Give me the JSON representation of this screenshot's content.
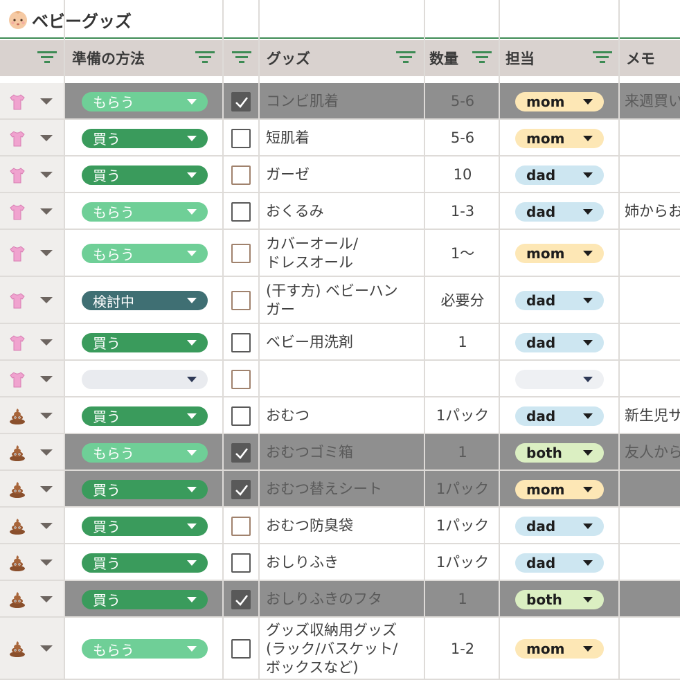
{
  "title": "ベビーグッズ",
  "title_icon": "baby-face-icon",
  "headers": {
    "method": "準備の方法",
    "goods": "グッズ",
    "quantity": "数量",
    "assignee": "担当",
    "memo": "メモ"
  },
  "colors": {
    "header_bg": "#d9d2cf",
    "header_line": "#3d8b54",
    "checked_row": "#8f8f8f",
    "method_もらう": "#6fcf97",
    "method_買う": "#3a9b5c",
    "method_検討中": "#3f6f73",
    "assignee_mom": "#fde7b5",
    "assignee_dad": "#cde6f1",
    "assignee_both": "#dbefc2"
  },
  "rows": [
    {
      "category_icon": "shirt-icon",
      "method": "もらう",
      "checked": true,
      "goods": "コンビ肌着",
      "qty": "5-6",
      "assignee": "mom",
      "memo": "来週買い"
    },
    {
      "category_icon": "shirt-icon",
      "method": "買う",
      "checked": false,
      "goods": "短肌着",
      "qty": "5-6",
      "assignee": "mom",
      "memo": ""
    },
    {
      "category_icon": "shirt-icon",
      "method": "買う",
      "checked": false,
      "goods": "ガーゼ",
      "qty": "10",
      "assignee": "dad",
      "memo": ""
    },
    {
      "category_icon": "shirt-icon",
      "method": "もらう",
      "checked": false,
      "goods": "おくるみ",
      "qty": "1-3",
      "assignee": "dad",
      "memo": "姉からお"
    },
    {
      "category_icon": "shirt-icon",
      "method": "もらう",
      "checked": false,
      "goods": "カバーオール/ドレスオール",
      "qty": "1〜",
      "assignee": "mom",
      "memo": ""
    },
    {
      "category_icon": "shirt-icon",
      "method": "検討中",
      "checked": false,
      "goods": "(干す方) ベビーハンガー",
      "qty": "必要分",
      "assignee": "dad",
      "memo": ""
    },
    {
      "category_icon": "shirt-icon",
      "method": "買う",
      "checked": false,
      "goods": "ベビー用洗剤",
      "qty": "1",
      "assignee": "dad",
      "memo": ""
    },
    {
      "category_icon": "shirt-icon",
      "method": "",
      "checked": false,
      "goods": "",
      "qty": "",
      "assignee": "",
      "memo": ""
    },
    {
      "category_icon": "poop-icon",
      "method": "買う",
      "checked": false,
      "goods": "おむつ",
      "qty": "1パック",
      "assignee": "dad",
      "memo": "新生児サ"
    },
    {
      "category_icon": "poop-icon",
      "method": "もらう",
      "checked": true,
      "goods": "おむつゴミ箱",
      "qty": "1",
      "assignee": "both",
      "memo": "友人から"
    },
    {
      "category_icon": "poop-icon",
      "method": "買う",
      "checked": true,
      "goods": "おむつ替えシート",
      "qty": "1パック",
      "assignee": "mom",
      "memo": ""
    },
    {
      "category_icon": "poop-icon",
      "method": "買う",
      "checked": false,
      "goods": "おむつ防臭袋",
      "qty": "1パック",
      "assignee": "dad",
      "memo": ""
    },
    {
      "category_icon": "poop-icon",
      "method": "買う",
      "checked": false,
      "goods": "おしりふき",
      "qty": "1パック",
      "assignee": "dad",
      "memo": ""
    },
    {
      "category_icon": "poop-icon",
      "method": "買う",
      "checked": true,
      "goods": "おしりふきのフタ",
      "qty": "1",
      "assignee": "both",
      "memo": ""
    },
    {
      "category_icon": "poop-icon",
      "method": "もらう",
      "checked": false,
      "goods": "グッズ収納用グッズ(ラック/バスケット/ボックスなど)",
      "qty": "1-2",
      "assignee": "mom",
      "memo": ""
    }
  ]
}
